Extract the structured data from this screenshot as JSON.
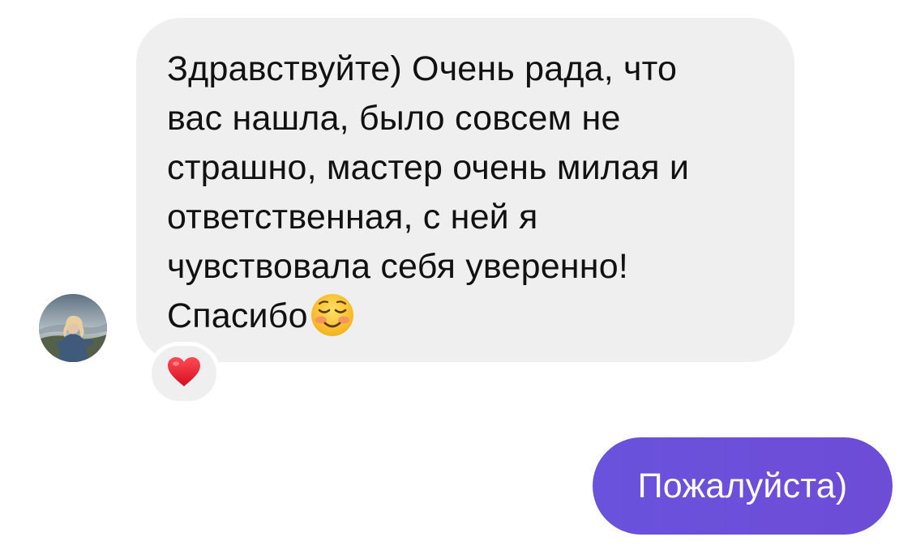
{
  "conversation": {
    "incoming": {
      "lines": [
        "Здравствуйте) Очень рада, что",
        "вас нашла, было совсем не",
        "страшно, мастер очень милая и",
        "ответственная, с ней я",
        "чувствовала себя уверенно!",
        "Спасибо"
      ],
      "trailing_emoji": "smiling-face-icon",
      "reaction": "heart-icon",
      "avatar": "user-avatar"
    },
    "outgoing": {
      "text": "Пожалуйста)"
    }
  },
  "colors": {
    "incoming_bubble": "#efefef",
    "outgoing_bubble": "#6b4fd8",
    "heart": "#e0202e"
  }
}
